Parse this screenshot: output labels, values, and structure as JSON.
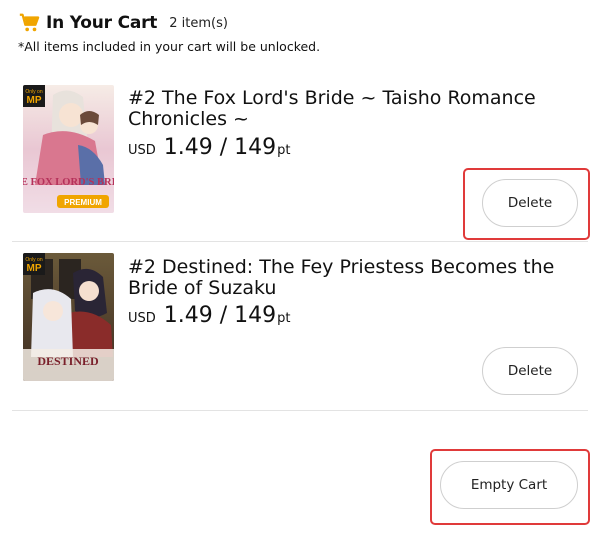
{
  "header": {
    "title": "In Your Cart",
    "count": "2 item(s)",
    "note": "*All items included in your cart will be unlocked.",
    "icon": "cart-icon",
    "icon_color": "#f0a500"
  },
  "items": [
    {
      "title": "#2 The Fox Lord's Bride ~ Taisho Romance Chronicles ~",
      "currency": "USD",
      "price": "1.49 / 149",
      "unit": "pt",
      "delete_label": "Delete",
      "cover": {
        "badge_top": "Only on",
        "badge_logo": "MP",
        "cover_title": "THE FOX LORD'S BRIDE",
        "ribbon": "PREMIUM"
      }
    },
    {
      "title": "#2 Destined: The Fey Priestess Becomes the Bride of Suzaku",
      "currency": "USD",
      "price": "1.49 / 149",
      "unit": "pt",
      "delete_label": "Delete",
      "cover": {
        "badge_top": "Only on",
        "badge_logo": "MP",
        "cover_title": "DESTINED"
      }
    }
  ],
  "footer": {
    "empty_cart_label": "Empty Cart"
  },
  "colors": {
    "highlight": "#e03a3a",
    "badge": "#f0a500"
  }
}
